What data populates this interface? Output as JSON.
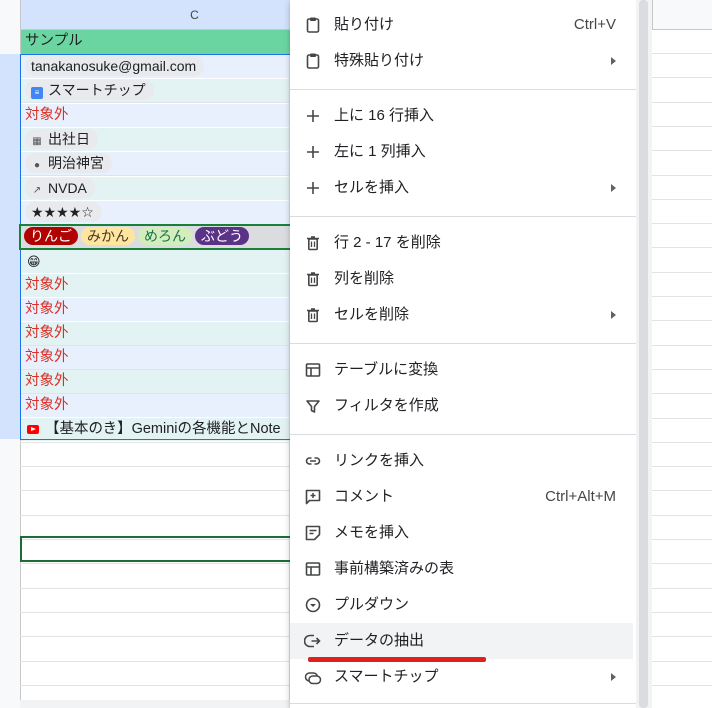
{
  "sheet": {
    "column_header_c": "C",
    "rows": [
      {
        "type": "header",
        "text": "サンプル"
      },
      {
        "type": "chip",
        "icon": "email",
        "text": "tanakanosuke@gmail.com"
      },
      {
        "type": "chip",
        "icon": "doc",
        "text": "スマートチップ"
      },
      {
        "type": "red",
        "text": "対象外"
      },
      {
        "type": "chip",
        "icon": "calendar",
        "text": "出社日"
      },
      {
        "type": "chip",
        "icon": "place",
        "text": "明治神宮"
      },
      {
        "type": "chip",
        "icon": "finance",
        "text": "NVDA"
      },
      {
        "type": "chip",
        "icon": "none",
        "text": "★★★★☆"
      },
      {
        "type": "dropdowns"
      },
      {
        "type": "emoji",
        "text": "😁"
      },
      {
        "type": "red",
        "text": "対象外"
      },
      {
        "type": "red",
        "text": "対象外"
      },
      {
        "type": "red",
        "text": "対象外"
      },
      {
        "type": "red",
        "text": "対象外"
      },
      {
        "type": "red",
        "text": "対象外"
      },
      {
        "type": "red",
        "text": "対象外"
      },
      {
        "type": "youtube",
        "text": "【基本のき】Geminiの各機能とNote"
      }
    ],
    "dropdown_chips": [
      {
        "text": "りんご",
        "bg": "#b10202",
        "fg": "#ffffff"
      },
      {
        "text": "みかん",
        "bg": "#ffe5a0",
        "fg": "#473821"
      },
      {
        "text": "めろん",
        "bg": "#d4edbc",
        "fg": "#11734b"
      },
      {
        "text": "ぶどう",
        "bg": "#5a3286",
        "fg": "#ffffff"
      }
    ]
  },
  "menu": {
    "paste": {
      "label": "貼り付け",
      "shortcut": "Ctrl+V"
    },
    "paste_special": {
      "label": "特殊貼り付け"
    },
    "insert_rows": {
      "label": "上に 16 行挿入"
    },
    "insert_cols": {
      "label": "左に 1 列挿入"
    },
    "insert_cells": {
      "label": "セルを挿入"
    },
    "delete_rows": {
      "label": "行 2 - 17 を削除"
    },
    "delete_col": {
      "label": "列を削除"
    },
    "delete_cells": {
      "label": "セルを削除"
    },
    "convert_table": {
      "label": "テーブルに変換"
    },
    "create_filter": {
      "label": "フィルタを作成"
    },
    "insert_link": {
      "label": "リンクを挿入"
    },
    "comment": {
      "label": "コメント",
      "shortcut": "Ctrl+Alt+M"
    },
    "insert_note": {
      "label": "メモを挿入"
    },
    "prebuilt_table": {
      "label": "事前構築済みの表"
    },
    "dropdown": {
      "label": "プルダウン"
    },
    "data_extraction": {
      "label": "データの抽出"
    },
    "smart_chips": {
      "label": "スマートチップ"
    }
  },
  "colors": {
    "header_fill": "#6ad5a0",
    "highlight": "#e8f0fe",
    "out_of_scope_text": "#d93025",
    "annotation_underline": "#e0201e"
  }
}
